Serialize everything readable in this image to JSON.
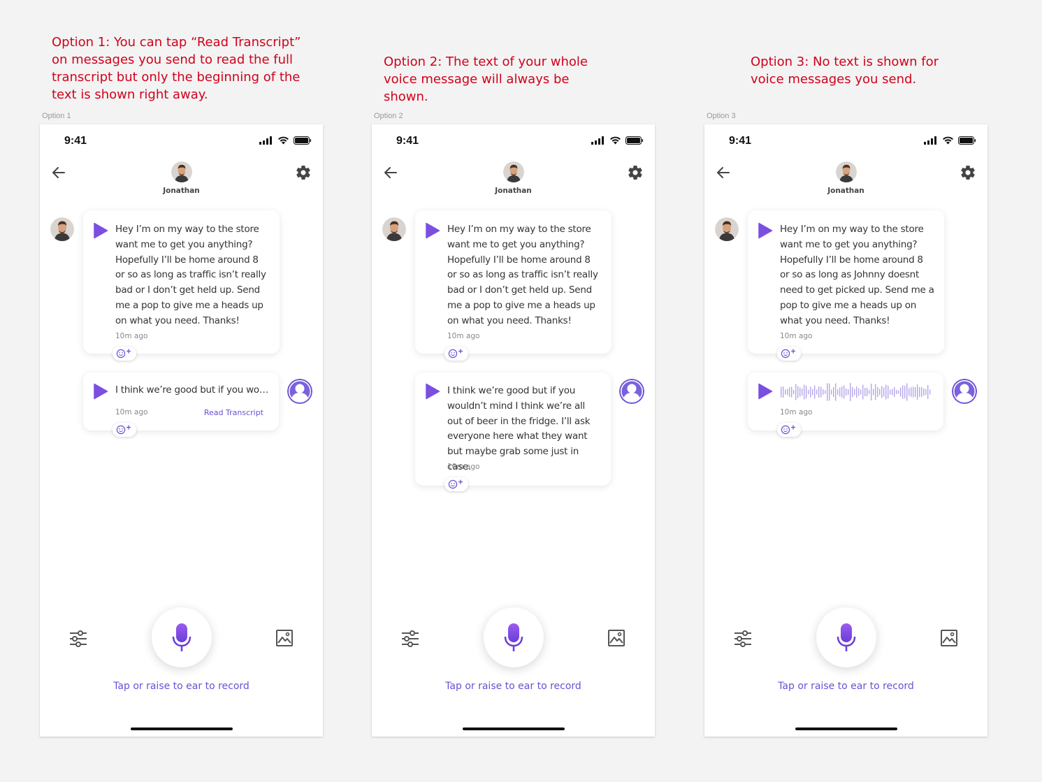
{
  "annotations": [
    "Option 1: You can tap “Read Transcript” on messages you send to read the full transcript but only the beginning of the text is shown right away.",
    "Option 2: The text of your whole voice message will always be shown.",
    "Option 3: No text is shown for voice messages you send."
  ],
  "frames": [
    {
      "label": "Option 1",
      "status_time": "9:41",
      "contact_name": "Jonathan",
      "incoming": {
        "text": "Hey I’m on my way to the store want me to get you anything? Hopefully I’ll be home around 8 or so as long as traffic isn’t really bad or I don’t get held up. Send me a pop to give me a heads up on what you need. Thanks!",
        "time": "10m ago"
      },
      "outgoing": {
        "text": "I think we’re good but if you wo…",
        "time": "10m ago",
        "read_transcript": "Read Transcript"
      },
      "hint": "Tap or raise to ear to record"
    },
    {
      "label": "Option 2",
      "status_time": "9:41",
      "contact_name": "Jonathan",
      "incoming": {
        "text": "Hey I’m on my way to the store want me to get you anything? Hopefully I’ll be home around 8 or so as long as traffic isn’t really bad or I don’t get held up. Send me a pop to give me a heads up on what you need. Thanks!",
        "time": "10m ago"
      },
      "outgoing": {
        "text": "I think we’re good but if you wouldn’t mind I think we’re all out of beer in the fridge. I’ll ask everyone here what they want but maybe grab some just in case.",
        "time": "10m ago"
      },
      "hint": "Tap or raise to ear to record"
    },
    {
      "label": "Option 3",
      "status_time": "9:41",
      "contact_name": "Jonathan",
      "incoming": {
        "text": "Hey I’m on my way to the store want me to get you anything? Hopefully I’ll be home around 8 or so as long as Johnny doesnt need to get picked up. Send me a pop to give me a heads up on what you need. Thanks!",
        "time": "10m ago"
      },
      "outgoing": {
        "time": "10m ago"
      },
      "hint": "Tap or raise to ear to record"
    }
  ],
  "colors": {
    "accent": "#6c4fd6",
    "annotation": "#d0021b",
    "play": "#7b4fe0",
    "waveform": "#b7a6ea"
  }
}
